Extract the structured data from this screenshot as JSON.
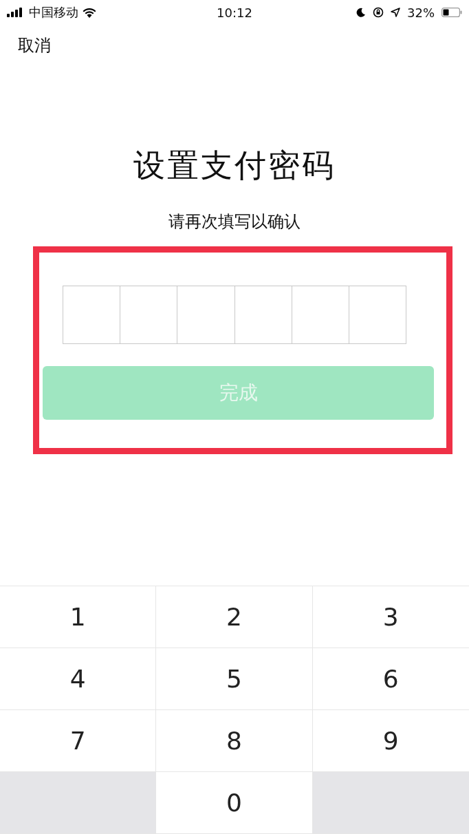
{
  "status_bar": {
    "carrier": "中国移动",
    "time": "10:12",
    "battery": "32%"
  },
  "cancel": "取消",
  "title": "设置支付密码",
  "subtitle": "请再次填写以确认",
  "highlight": true,
  "pin_cells": [
    {
      "filled": false
    },
    {
      "filled": false
    },
    {
      "filled": false
    },
    {
      "filled": false
    },
    {
      "filled": false
    },
    {
      "filled": false
    }
  ],
  "done_button": {
    "label": "完成",
    "disabled": true
  },
  "keypad": [
    {
      "kind": "digit",
      "label": "1"
    },
    {
      "kind": "digit",
      "label": "2"
    },
    {
      "kind": "digit",
      "label": "3"
    },
    {
      "kind": "digit",
      "label": "4"
    },
    {
      "kind": "digit",
      "label": "5"
    },
    {
      "kind": "digit",
      "label": "6"
    },
    {
      "kind": "digit",
      "label": "7"
    },
    {
      "kind": "digit",
      "label": "8"
    },
    {
      "kind": "digit",
      "label": "9"
    },
    {
      "kind": "blank"
    },
    {
      "kind": "digit",
      "label": "0"
    },
    {
      "kind": "blank"
    }
  ]
}
